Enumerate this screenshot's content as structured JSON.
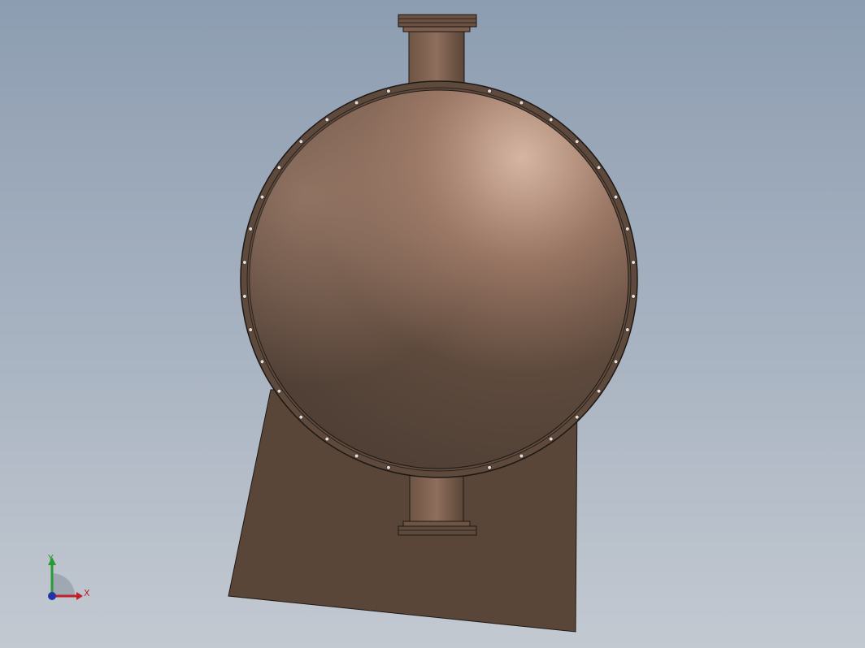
{
  "viewport": {
    "background_top": "#8d9db1",
    "background_bottom": "#c3c9d1",
    "model": {
      "body_color": "#7a5d4c",
      "support_color": "#5a4638",
      "flange_color": "#5e4a3d",
      "highlight_color": "#d6b6a2",
      "bolt_color": "#e4dcd6",
      "bolt_count": 36
    }
  },
  "triad": {
    "x_label": "X",
    "y_label": "Y",
    "x_color": "#c0202a",
    "y_color": "#2a9a32",
    "z_color": "#2233aa"
  }
}
